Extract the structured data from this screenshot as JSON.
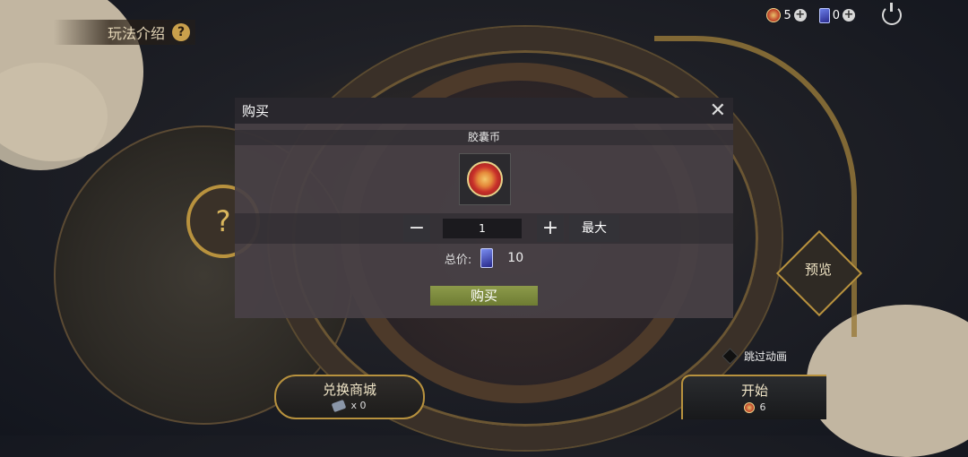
{
  "topbar": {
    "coin_count": "5",
    "card_count": "0"
  },
  "rules_label": "玩法介绍",
  "preview_label": "预览",
  "skip_animation_label": "跳过动画",
  "exchange": {
    "label": "兑换商城",
    "count": "x 0"
  },
  "start": {
    "label": "开始",
    "count": "6"
  },
  "modal": {
    "title": "购买",
    "item_name": "胶囊币",
    "quantity": "1",
    "minus_label": "−",
    "plus_label": "+",
    "max_label": "最大",
    "total_label": "总价:",
    "total_value": "10",
    "buy_label": "购买"
  },
  "icons": {
    "coin": "capsule-coin-icon",
    "card": "card-currency-icon",
    "power": "power-icon",
    "help": "help-icon",
    "close": "close-icon"
  }
}
